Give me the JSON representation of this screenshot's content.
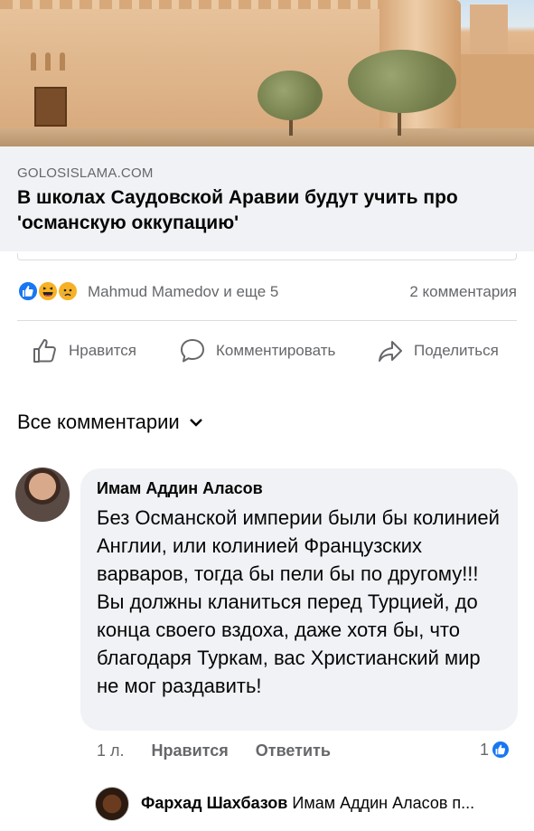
{
  "link_preview": {
    "domain": "GOLOSISLAMA.COM",
    "title": "В школах Саудовской Аравии будут учить про 'османскую оккупацию'"
  },
  "reactions": {
    "icons": [
      "like-icon",
      "haha-icon",
      "sad-icon"
    ],
    "reactors_text": "Mahmud Mamedov и еще 5",
    "comments_count": "2 комментария"
  },
  "actions": {
    "like": "Нравится",
    "comment": "Комментировать",
    "share": "Поделиться"
  },
  "comments_filter": {
    "label": "Все комментарии"
  },
  "comment": {
    "author": "Имам Аддин Аласов",
    "text": "Без Османской империи были бы колинией Англии, или колинией Французских варваров, тогда бы пели бы по другому!!! Вы должны кланиться перед Турцией, до конца своего вздоха, даже хотя бы, что благодаря Туркам, вас Христианский мир не мог раздавить!",
    "time": "1 л.",
    "like_label": "Нравится",
    "reply_label": "Ответить",
    "like_count": "1"
  },
  "reply_preview": {
    "author": "Фархад Шахбазов",
    "text": "Имам Аддин Аласов п..."
  },
  "colors": {
    "accent": "#1877f2",
    "secondary_text": "#65676b",
    "bubble": "#f0f2f5"
  }
}
